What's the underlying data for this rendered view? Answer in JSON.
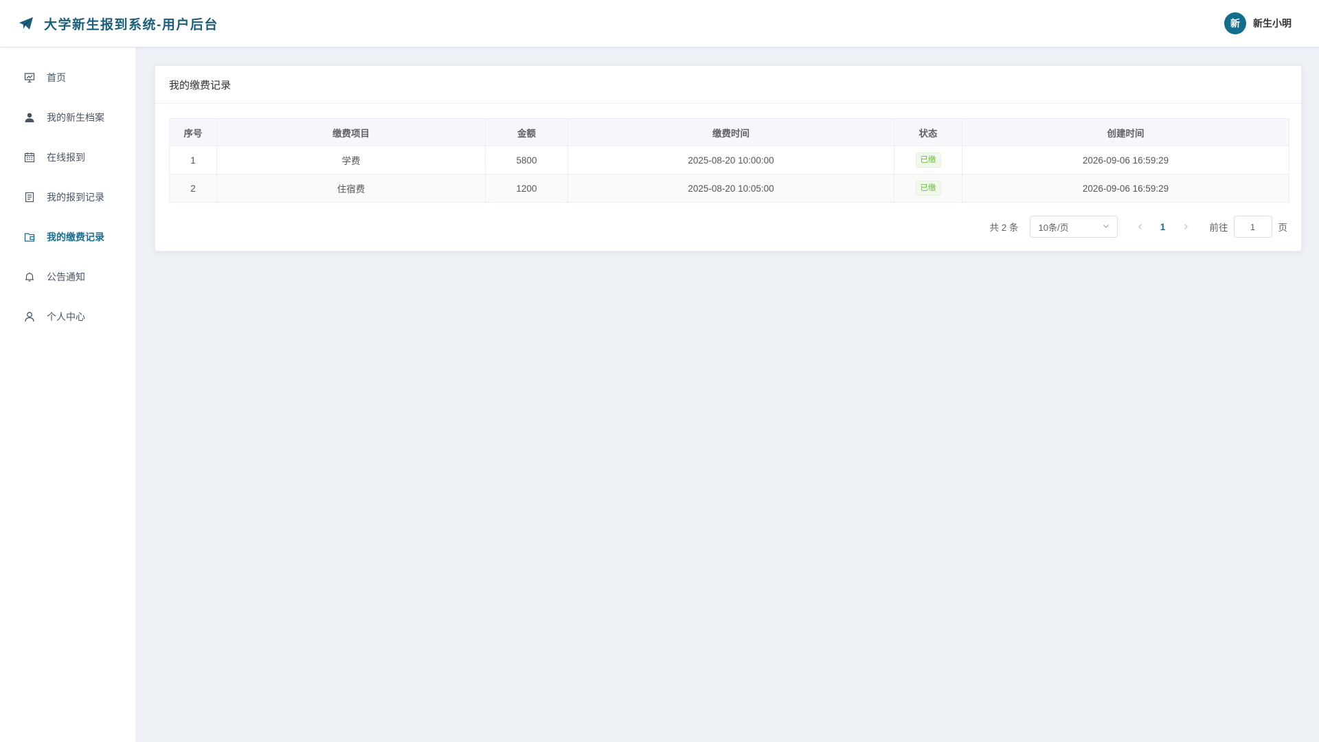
{
  "header": {
    "logo_icon": "paper-plane-icon",
    "title": "大学新生报到系统-用户后台",
    "user": {
      "avatar_text": "新",
      "name": "新生小明"
    },
    "accent_color": "#126e8c"
  },
  "sidebar": {
    "items": [
      {
        "label": "首页",
        "icon": "presentation-icon",
        "active": false
      },
      {
        "label": "我的新生档案",
        "icon": "user-icon",
        "active": false
      },
      {
        "label": "在线报到",
        "icon": "calendar-icon",
        "active": false
      },
      {
        "label": "我的报到记录",
        "icon": "document-icon",
        "active": false
      },
      {
        "label": "我的缴费记录",
        "icon": "wallet-icon",
        "active": true
      },
      {
        "label": "公告通知",
        "icon": "bell-icon",
        "active": false
      },
      {
        "label": "个人中心",
        "icon": "person-outline-icon",
        "active": false
      }
    ]
  },
  "main": {
    "card_title": "我的缴费记录",
    "table": {
      "columns": [
        "序号",
        "缴费项目",
        "金额",
        "缴费时间",
        "状态",
        "创建时间"
      ],
      "rows": [
        {
          "index": "1",
          "item": "学费",
          "amount": "5800",
          "pay_time": "2025-08-20 10:00:00",
          "status": "已缴",
          "created": "2026-09-06 16:59:29"
        },
        {
          "index": "2",
          "item": "住宿费",
          "amount": "1200",
          "pay_time": "2025-08-20 10:05:00",
          "status": "已缴",
          "created": "2026-09-06 16:59:29"
        }
      ]
    },
    "pagination": {
      "total_text": "共 2 条",
      "page_size": "10条/页",
      "current_page": "1",
      "goto_label": "前往",
      "goto_value": "1",
      "page_unit": "页"
    }
  }
}
